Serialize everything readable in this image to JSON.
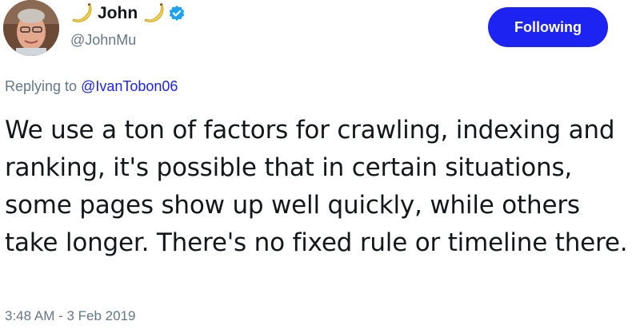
{
  "author": {
    "display_name": "John",
    "handle": "@JohnMu",
    "verified": true,
    "name_decorations": [
      "banana-icon",
      "banana-icon"
    ],
    "avatar": "profile-photo"
  },
  "follow_button": {
    "label": "Following",
    "color": "#1d23f0"
  },
  "reply_context": {
    "prefix": "Replying to",
    "mention": "@IvanTobon06"
  },
  "tweet": {
    "text": "We use a ton of factors for crawling, indexing and ranking, it's possible that in certain situations, some pages show up well quickly, while others take longer. There's no fixed rule or timeline there.",
    "timestamp": "3:48 AM - 3 Feb 2019"
  },
  "colors": {
    "accent": "#1d23f0",
    "muted": "#657786",
    "text": "#14171a",
    "verified_badge": "#1da1f2",
    "banana": "#f5d547"
  }
}
